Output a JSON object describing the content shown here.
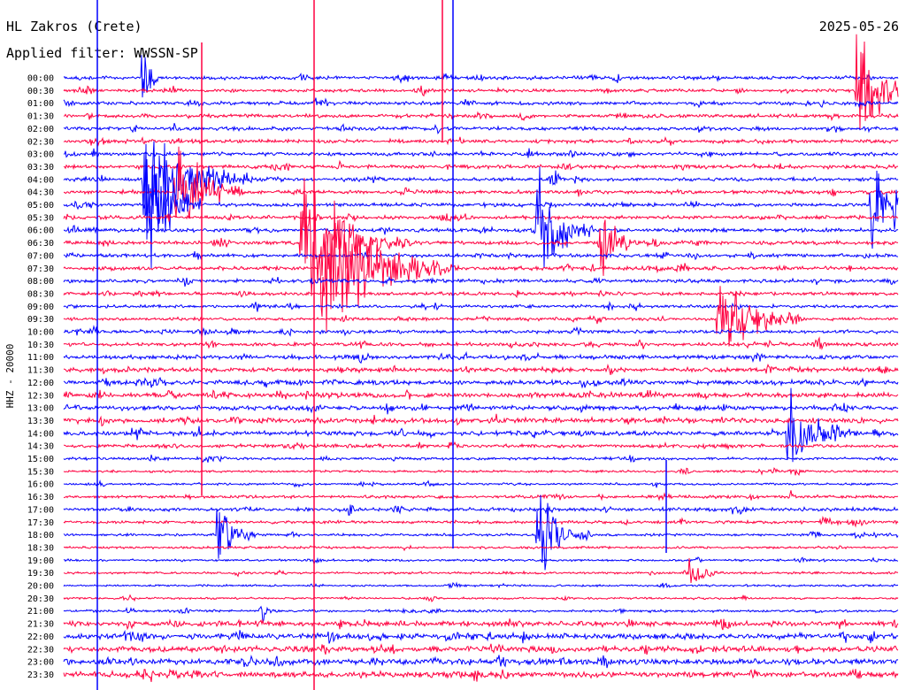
{
  "header": {
    "station": "HL Zakros (Crete)",
    "date": "2025-05-26",
    "filter": "Applied filter: WWSSN-SP"
  },
  "side_label": "HHZ - 20000",
  "colors": {
    "odd_row": "#0000ff",
    "even_row": "#ff0040",
    "text": "#000000"
  },
  "chart_data": {
    "type": "line",
    "title": "HL Zakros (Crete)",
    "subtitle": "Applied filter: WWSSN-SP",
    "date": "2025-05-26",
    "channel_label": "HHZ - 20000",
    "row_labels": [
      "00:00",
      "00:30",
      "01:00",
      "01:30",
      "02:00",
      "02:30",
      "03:00",
      "03:30",
      "04:00",
      "04:30",
      "05:00",
      "05:30",
      "06:00",
      "06:30",
      "07:00",
      "07:30",
      "08:00",
      "08:30",
      "09:00",
      "09:30",
      "10:00",
      "10:30",
      "11:00",
      "11:30",
      "12:00",
      "12:30",
      "13:00",
      "13:30",
      "14:00",
      "14:30",
      "15:00",
      "15:30",
      "16:00",
      "16:30",
      "17:00",
      "17:30",
      "18:00",
      "18:30",
      "19:00",
      "19:30",
      "20:00",
      "20:30",
      "21:00",
      "21:30",
      "22:00",
      "22:30",
      "23:00",
      "23:30"
    ],
    "noise_level": [
      1.6,
      1.4,
      1.6,
      1.6,
      1.6,
      1.6,
      1.6,
      1.6,
      1.6,
      1.6,
      1.6,
      1.6,
      1.6,
      1.6,
      1.5,
      1.6,
      1.6,
      1.4,
      1.4,
      1.4,
      1.5,
      1.5,
      1.8,
      1.9,
      2.0,
      2.0,
      2.0,
      2.2,
      2.0,
      1.5,
      1.2,
      1.0,
      1.0,
      1.3,
      1.6,
      1.3,
      1.1,
      1.0,
      1.0,
      1.0,
      0.9,
      0.9,
      1.1,
      2.2,
      2.4,
      2.4,
      2.4,
      2.4
    ],
    "events": [
      {
        "row": 0,
        "minute": 2.8,
        "amplitude": 9,
        "duration_min": 0.6,
        "color": "blue"
      },
      {
        "row": 1,
        "minute": 28.5,
        "amplitude": 8,
        "duration_min": 2.0,
        "color": "red"
      },
      {
        "row": 8,
        "minute": 2.8,
        "amplitude": 9,
        "duration_min": 4.0,
        "color": "blue"
      },
      {
        "row": 9,
        "minute": 4.0,
        "amplitude": 8,
        "duration_min": 2.5,
        "color": "red"
      },
      {
        "row": 10,
        "minute": 2.9,
        "amplitude": 9,
        "duration_min": 2.0,
        "color": "blue"
      },
      {
        "row": 10,
        "minute": 29.0,
        "amplitude": 9,
        "duration_min": 2.0,
        "color": "blue"
      },
      {
        "row": 13,
        "minute": 8.5,
        "amplitude": 9,
        "duration_min": 4.0,
        "color": "red"
      },
      {
        "row": 15,
        "minute": 9.2,
        "amplitude": 9,
        "duration_min": 5.0,
        "color": "red"
      },
      {
        "row": 12,
        "minute": 17.0,
        "amplitude": 9,
        "duration_min": 2.0,
        "color": "red"
      },
      {
        "row": 13,
        "minute": 19.2,
        "amplitude": 5,
        "duration_min": 1.5,
        "color": "red"
      },
      {
        "row": 16,
        "minute": 31.0,
        "amplitude": 5,
        "duration_min": 2.0,
        "color": "blue"
      },
      {
        "row": 19,
        "minute": 23.5,
        "amplitude": 6,
        "duration_min": 3.0,
        "color": "red"
      },
      {
        "row": 28,
        "minute": 26.0,
        "amplitude": 5,
        "duration_min": 2.5,
        "color": "blue"
      },
      {
        "row": 28,
        "minute": 55.5,
        "amplitude": 6,
        "duration_min": 1.5,
        "color": "blue"
      },
      {
        "row": 36,
        "minute": 17.0,
        "amplitude": 6,
        "duration_min": 2.0,
        "color": "blue"
      },
      {
        "row": 36,
        "minute": 5.5,
        "amplitude": 4,
        "duration_min": 1.5,
        "color": "blue"
      },
      {
        "row": 35,
        "minute": 42.5,
        "amplitude": 4,
        "duration_min": 0.8,
        "color": "blue"
      },
      {
        "row": 39,
        "minute": 22.5,
        "amplitude": 3,
        "duration_min": 1.0,
        "color": "red"
      },
      {
        "row": 41,
        "minute": 52.5,
        "amplitude": 3,
        "duration_min": 1.0,
        "color": "red"
      },
      {
        "row": 42,
        "minute": 7.0,
        "amplitude": 2,
        "duration_min": 0.8,
        "color": "blue"
      }
    ],
    "grid": false
  }
}
